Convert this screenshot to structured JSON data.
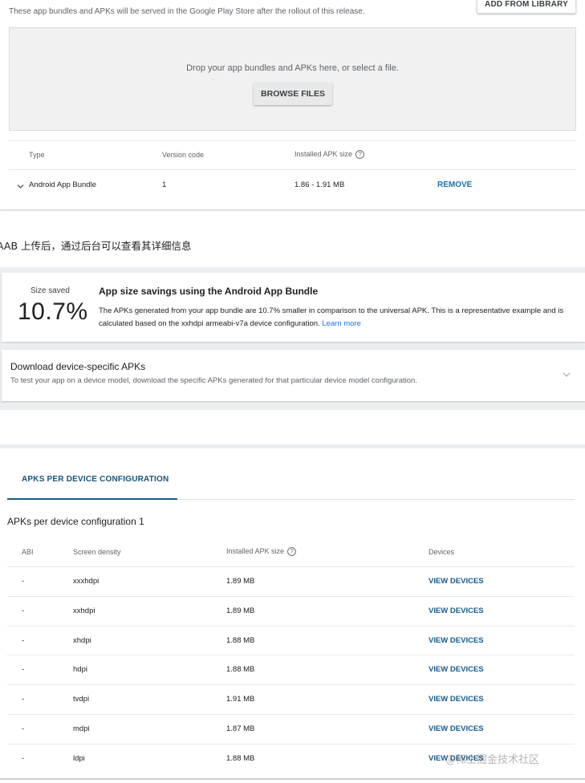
{
  "release": {
    "description": "These app bundles and APKs will be served in the Google Play Store after the rollout of this release.",
    "add_from_library": "ADD FROM LIBRARY",
    "dropzone_text": "Drop your app bundles and APKs here, or select a file.",
    "browse_files": "BROWSE FILES",
    "columns": {
      "type": "Type",
      "version_code": "Version code",
      "installed_size": "Installed APK size"
    },
    "row": {
      "type": "Android App Bundle",
      "version_code": "1",
      "size": "1.86 - 1.91 MB",
      "action": "REMOVE"
    }
  },
  "caption": "AAB 上传后，通过后台可以查看其详细信息",
  "savings": {
    "label": "Size saved",
    "value": "10.7%",
    "title": "App size savings using the Android App Bundle",
    "body": "The APKs generated from your app bundle are 10.7% smaller in comparison to the universal APK. This is a representative example and is calculated based on the xxhdpi armeabi-v7a device configuration.",
    "learn_more": "Learn more"
  },
  "download": {
    "title": "Download device-specific APKs",
    "body": "To test your app on a device model, download the specific APKs generated for that particular device model configuration."
  },
  "apks": {
    "tab": "APKS PER DEVICE CONFIGURATION",
    "section_title": "APKs per device configuration 1",
    "columns": {
      "abi": "ABI",
      "density": "Screen density",
      "size": "Installed APK size",
      "devices": "Devices"
    },
    "rows": [
      {
        "abi": "-",
        "density": "xxxhdpi",
        "size": "1.89 MB",
        "action": "VIEW DEVICES"
      },
      {
        "abi": "-",
        "density": "xxhdpi",
        "size": "1.89 MB",
        "action": "VIEW DEVICES"
      },
      {
        "abi": "-",
        "density": "xhdpi",
        "size": "1.88 MB",
        "action": "VIEW DEVICES"
      },
      {
        "abi": "-",
        "density": "hdpi",
        "size": "1.88 MB",
        "action": "VIEW DEVICES"
      },
      {
        "abi": "-",
        "density": "tvdpi",
        "size": "1.91 MB",
        "action": "VIEW DEVICES"
      },
      {
        "abi": "-",
        "density": "mdpi",
        "size": "1.87 MB",
        "action": "VIEW DEVICES"
      },
      {
        "abi": "-",
        "density": "ldpi",
        "size": "1.88 MB",
        "action": "VIEW DEVICES"
      }
    ]
  },
  "watermark": "@稀土掘金技术社区",
  "help_glyph": "?"
}
